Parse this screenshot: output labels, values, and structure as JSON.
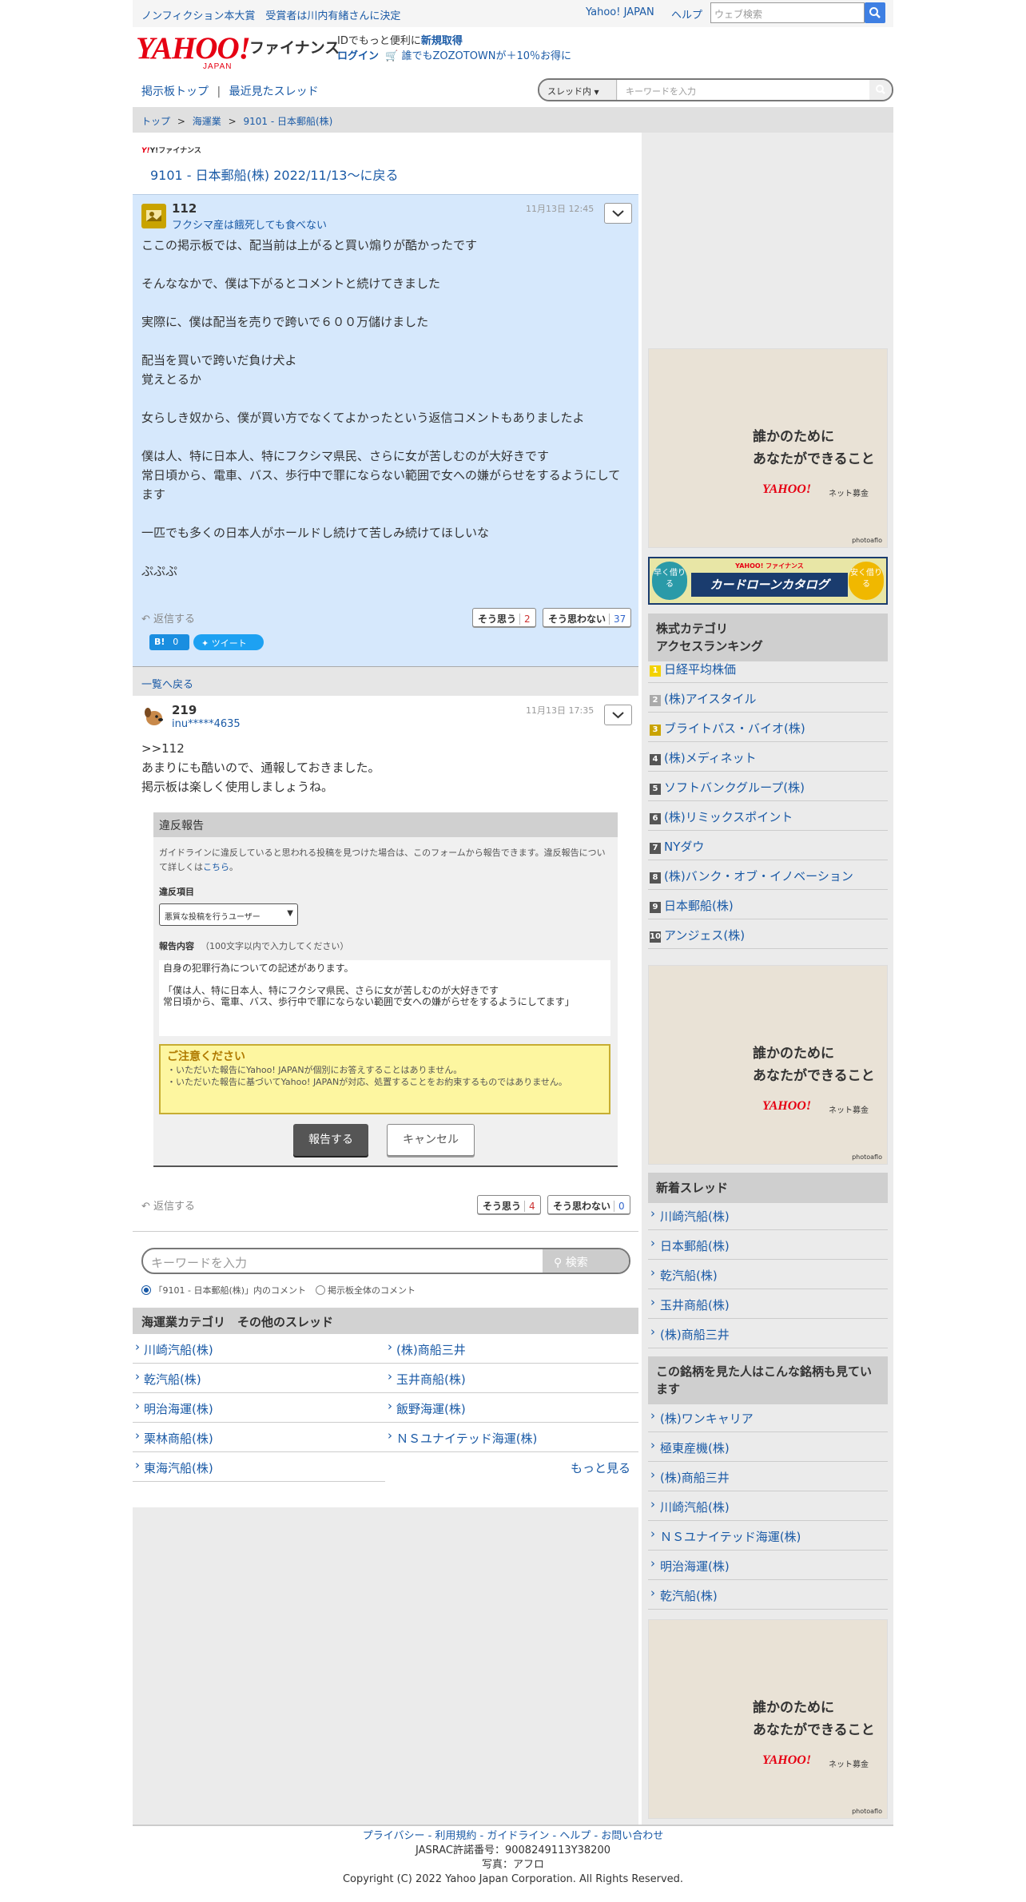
{
  "topbar": {
    "promo": "ノンフィクション本大賞　受賞者は川内有緒さんに決定",
    "yahoo_japan": "Yahoo! JAPAN",
    "help": "ヘルプ",
    "web_search_placeholder": "ウェブ検索"
  },
  "header": {
    "logo_text": "YAHOO!",
    "logo_sub": "JAPAN",
    "finance": "ファイナンス",
    "id_promo_prefix": "IDでもっと便利に",
    "id_promo_link": "新規取得",
    "login": "ログイン",
    "zozo_promo": "誰でもZOZOTOWNが＋10％お得に"
  },
  "subnav": {
    "board_top": "掲示板トップ",
    "sep": "|",
    "recent": "最近見たスレッド"
  },
  "thread_search": {
    "scope": "スレッド内",
    "placeholder": "キーワードを入力"
  },
  "breadcrumb": [
    "トップ",
    "海運業",
    "9101 - 日本郵船(株)"
  ],
  "thread_header": {
    "mini_logo": "Y!ファイナンス",
    "back_link": "9101 - 日本郵船(株) 2022/11/13〜に戻る"
  },
  "post1": {
    "number": "112",
    "author": "フクシマ産は餓死しても食べない",
    "time": "11月13日 12:45",
    "lines": [
      "ここの掲示板では、配当前は上がると買い煽りが酷かったです",
      "",
      "そんななかで、僕は下がるとコメントと続けてきました",
      "",
      "実際に、僕は配当を売りで跨いで６００万儲けました",
      "",
      "配当を買いで跨いだ負け犬よ",
      "覚えとるか",
      "",
      "女らしき奴から、僕が買い方でなくてよかったという返信コメントもありましたよ",
      "",
      "僕は人、特に日本人、特にフクシマ県民、さらに女が苦しむのが大好きです",
      "常日頃から、電車、バス、歩行中で罪にならない範囲で女への嫌がらせをするようにしてます",
      "",
      "一匹でも多くの日本人がホールドし続けて苦しみ続けてほしいな",
      "",
      "ぷぷぷ"
    ],
    "reply": "返信する",
    "agree": "そう思う",
    "agree_count": "2",
    "disagree": "そう思わない",
    "disagree_count": "37",
    "hatena_count": "0",
    "tweet": "ツイート"
  },
  "back_to_list": "一覧へ戻る",
  "post2": {
    "number": "219",
    "author": "inu*****4635",
    "time": "11月13日 17:35",
    "lines": [
      ">>112",
      "あまりにも酷いので、通報しておきました。",
      "掲示板は楽しく使用しましょうね。"
    ],
    "reply": "返信する",
    "agree": "そう思う",
    "agree_count": "4",
    "disagree": "そう思わない",
    "disagree_count": "0"
  },
  "report": {
    "title": "違反報告",
    "desc": "ガイドラインに違反していると思われる投稿を見つけた場合は、このフォームから報告できます。違反報告について詳しくは",
    "desc_link": "こちら",
    "desc_end": "。",
    "item_label": "違反項目",
    "item_value": "悪質な投稿を行うユーザー",
    "content_label": "報告内容",
    "content_hint": "（100文字以内で入力してください）",
    "content_text": "自身の犯罪行為についての記述があります。\n\n「僕は人、特に日本人、特にフクシマ県民、さらに女が苦しむのが大好きです\n常日頃から、電車、バス、歩行中で罪にならない範囲で女への嫌がらせをするようにしてます」",
    "caution_title": "ご注意ください",
    "caution_1": "・いただいた報告にYahoo! JAPANが個別にお答えすることはありません。",
    "caution_2": "・いただいた報告に基づいてYahoo! JAPANが対応、処置することをお約束するものではありません。",
    "submit": "報告する",
    "cancel": "キャンセル"
  },
  "bottom_search": {
    "placeholder": "キーワードを入力",
    "button": "検索",
    "radio1": "「9101 - 日本郵船(株)」内のコメント",
    "radio2": "掲示板全体のコメント"
  },
  "category": {
    "title": "海運業カテゴリ　その他のスレッド",
    "left": [
      "川崎汽船(株)",
      "乾汽船(株)",
      "明治海運(株)",
      "栗林商船(株)",
      "東海汽船(株)"
    ],
    "right": [
      "(株)商船三井",
      "玉井商船(株)",
      "飯野海運(株)",
      "ＮＳユナイテッド海運(株)"
    ],
    "more": "もっと見る"
  },
  "ad": {
    "line1": "誰かのために",
    "line2": "あなたができること",
    "brand": "YAHOO!",
    "brand_sub": "ネット募金",
    "credit": "photoaflo"
  },
  "cardloan": {
    "brand": "YAHOO! ファイナンス",
    "title": "カードローンカタログ",
    "left": "早く借りる",
    "right": "安く借りる"
  },
  "ranking": {
    "title": "株式カテゴリ\nアクセスランキング",
    "items": [
      "日経平均株価",
      "(株)アイスタイル",
      "ブライトパス・バイオ(株)",
      "(株)メディネット",
      "ソフトバンクグループ(株)",
      "(株)リミックスポイント",
      "NYダウ",
      "(株)バンク・オブ・イノベーション",
      "日本郵船(株)",
      "アンジェス(株)"
    ]
  },
  "new_threads": {
    "title": "新着スレッド",
    "items": [
      "川崎汽船(株)",
      "日本郵船(株)",
      "乾汽船(株)",
      "玉井商船(株)",
      "(株)商船三井"
    ]
  },
  "also_viewed": {
    "title": "この銘柄を見た人はこんな銘柄も見ています",
    "items": [
      "(株)ワンキャリア",
      "極東産機(株)",
      "(株)商船三井",
      "川崎汽船(株)",
      "ＮＳユナイテッド海運(株)",
      "明治海運(株)",
      "乾汽船(株)"
    ]
  },
  "footer": {
    "links": "プライバシー - 利用規約 - ガイドライン - ヘルプ - お問い合わせ",
    "jasrac": "JASRAC許諾番号：9008249113Y38200",
    "photo": "写真：アフロ",
    "copyright": "Copyright (C) 2022 Yahoo Japan Corporation. All Rights Reserved."
  },
  "colors": {
    "link": "#1a5aa6",
    "post_bg": "#d6e8fc",
    "accent": "#e60013"
  }
}
